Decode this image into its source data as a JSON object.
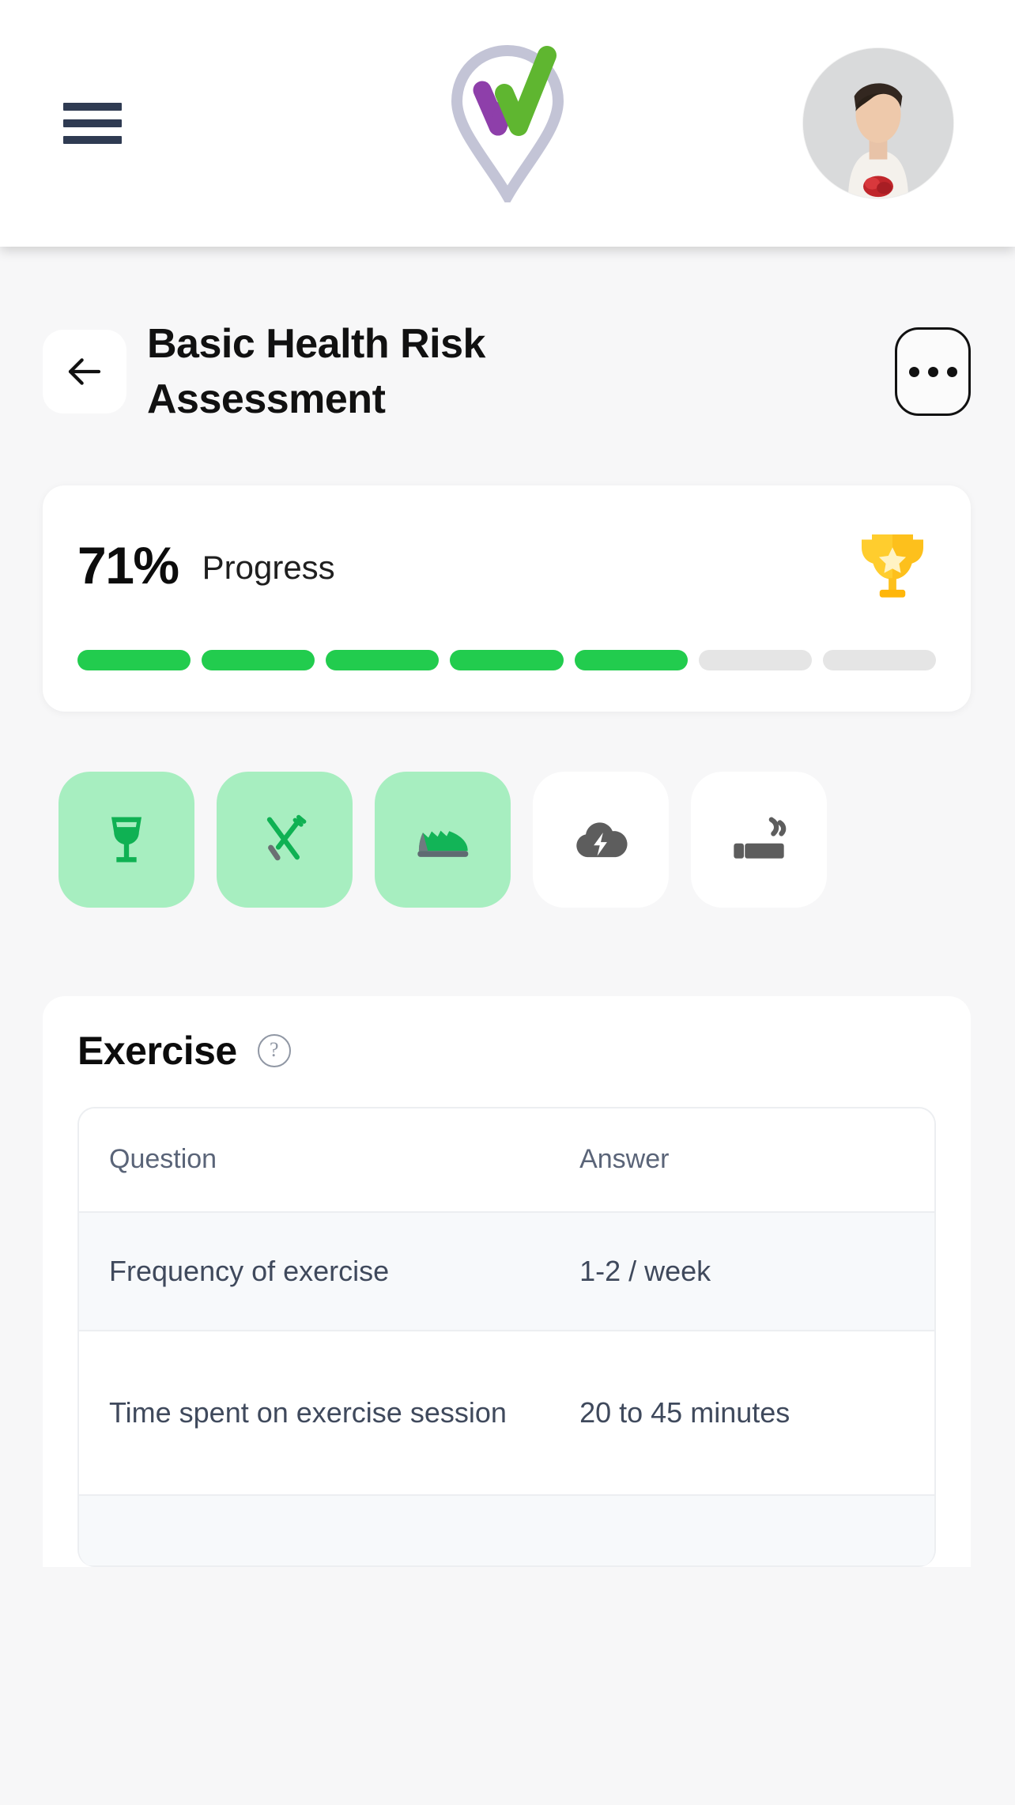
{
  "header": {
    "menu_icon": "hamburger-menu-icon",
    "logo_icon": "wellteq-pin-check-logo",
    "logo_colors": {
      "pin": "#c3c4d6",
      "w_purple": "#8e3faa",
      "check_green": "#5fb630"
    },
    "avatar_icon": "user-avatar-photo"
  },
  "page": {
    "back_icon": "arrow-left-icon",
    "title": "Basic Health Risk Assessment",
    "more_icon": "ellipsis-icon",
    "more_label": "•••"
  },
  "progress": {
    "percent_label": "71%",
    "label": "Progress",
    "trophy_icon": "trophy-icon",
    "total_segments": 7,
    "filled_segments": 5,
    "colors": {
      "filled": "#22cc4e",
      "empty": "#e5e5e5"
    }
  },
  "categories": [
    {
      "name": "alcohol",
      "icon": "wine-glass-icon",
      "active": true
    },
    {
      "name": "nutrition",
      "icon": "fork-knife-icon",
      "active": true
    },
    {
      "name": "exercise",
      "icon": "sneaker-shoe-icon",
      "active": true
    },
    {
      "name": "stress",
      "icon": "cloud-lightning-icon",
      "active": false
    },
    {
      "name": "smoking",
      "icon": "cigarette-icon",
      "active": false
    }
  ],
  "section": {
    "title": "Exercise",
    "help_icon": "question-mark-circle-icon",
    "help_glyph": "?"
  },
  "table": {
    "columns": [
      "Question",
      "Answer"
    ],
    "rows": [
      {
        "question": "Frequency of exercise",
        "answer": "1-2 / week"
      },
      {
        "question": "Time spent on exercise session",
        "answer": "20 to 45 minutes"
      },
      {
        "question": "",
        "answer": ""
      }
    ]
  },
  "theme": {
    "page_bg": "#f7f7f8",
    "card_bg": "#ffffff",
    "accent_green": "#22cc4e",
    "tile_green": "#a7eec0",
    "text_dark": "#0c0c0c",
    "text_muted": "#3f495c"
  }
}
